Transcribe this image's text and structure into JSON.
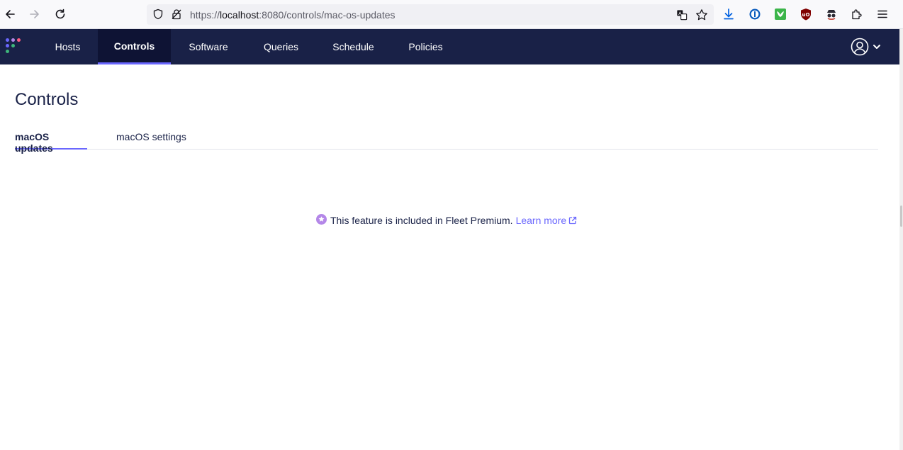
{
  "browser": {
    "url_prefix": "https://",
    "url_host": "localhost",
    "url_rest": ":8080/controls/mac-os-updates"
  },
  "nav": {
    "items": [
      {
        "label": "Hosts"
      },
      {
        "label": "Controls"
      },
      {
        "label": "Software"
      },
      {
        "label": "Queries"
      },
      {
        "label": "Schedule"
      },
      {
        "label": "Policies"
      }
    ],
    "active": "Controls"
  },
  "page": {
    "title": "Controls",
    "tabs": [
      {
        "label": "macOS updates"
      },
      {
        "label": "macOS settings"
      }
    ],
    "premium_message": "This feature is included in Fleet Premium.",
    "learn_more_label": "Learn more"
  },
  "colors": {
    "header_bg": "#192147",
    "accent": "#6a67fe",
    "premium_icon": "#b487e8"
  }
}
